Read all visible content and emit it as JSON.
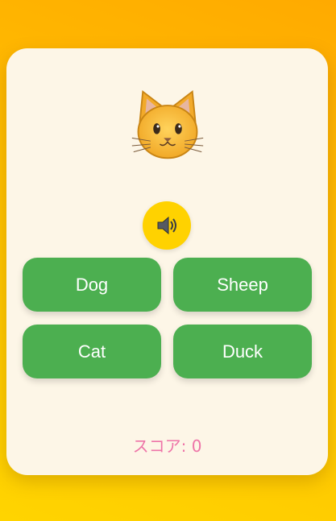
{
  "animal": {
    "icon": "cat-face-icon"
  },
  "sound_button": {
    "icon": "speaker-icon"
  },
  "options": [
    {
      "label": "Dog"
    },
    {
      "label": "Sheep"
    },
    {
      "label": "Cat"
    },
    {
      "label": "Duck"
    }
  ],
  "score": {
    "label": "スコア:",
    "value": "0"
  },
  "colors": {
    "button_green": "#4caf50",
    "score_pink": "#ee74a8",
    "sound_yellow": "#ffd200",
    "card_bg": "#fdf6e7"
  }
}
